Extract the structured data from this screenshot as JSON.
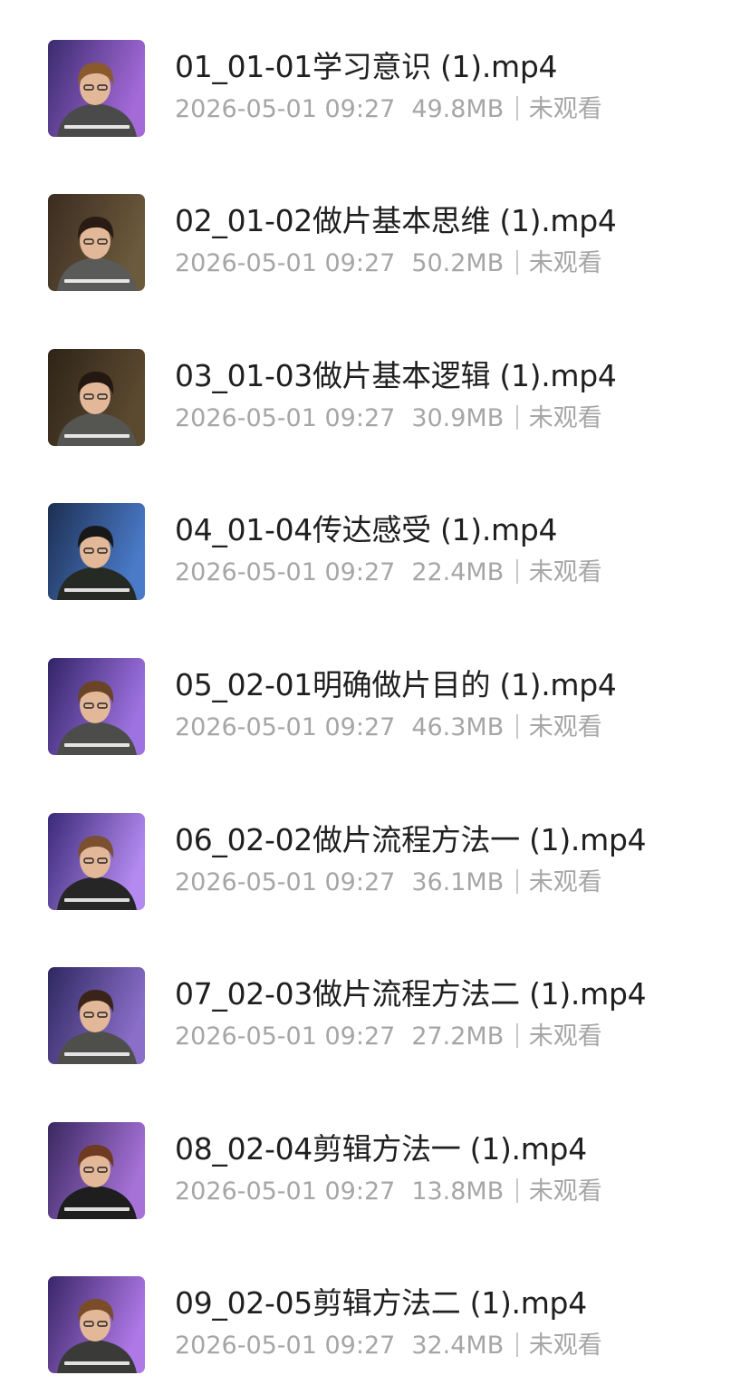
{
  "files": [
    {
      "name": "01_01-01学习意识 (1).mp4",
      "date": "2026-05-01 09:27",
      "size": "49.8MB",
      "status": "未观看",
      "thumb": {
        "bg1": "#3a2b6e",
        "bg2": "#a46ad8",
        "hair": "#8a5a2c",
        "shirt": "#4a4a4a",
        "caption": "#ffffff"
      }
    },
    {
      "name": "02_01-02做片基本思维 (1).mp4",
      "date": "2026-05-01 09:27",
      "size": "50.2MB",
      "status": "未观看",
      "thumb": {
        "bg1": "#3b2c20",
        "bg2": "#6b5a3c",
        "hair": "#2a1c14",
        "shirt": "#5a5a58",
        "caption": "#ffffff"
      }
    },
    {
      "name": "03_01-03做片基本逻辑 (1).mp4",
      "date": "2026-05-01 09:27",
      "size": "30.9MB",
      "status": "未观看",
      "thumb": {
        "bg1": "#2e2418",
        "bg2": "#5c4a30",
        "hair": "#231812",
        "shirt": "#555552",
        "caption": "#ffffff"
      }
    },
    {
      "name": "04_01-04传达感受 (1).mp4",
      "date": "2026-05-01 09:27",
      "size": "22.4MB",
      "status": "未观看",
      "thumb": {
        "bg1": "#1d2f52",
        "bg2": "#4a7ac8",
        "hair": "#181818",
        "shirt": "#262a24",
        "caption": "#ffffff"
      }
    },
    {
      "name": "05_02-01明确做片目的 (1).mp4",
      "date": "2026-05-01 09:27",
      "size": "46.3MB",
      "status": "未观看",
      "thumb": {
        "bg1": "#322468",
        "bg2": "#9e72e0",
        "hair": "#6a4426",
        "shirt": "#4c4c4a",
        "caption": "#ffffff"
      }
    },
    {
      "name": "06_02-02做片流程方法一 (1).mp4",
      "date": "2026-05-01 09:27",
      "size": "36.1MB",
      "status": "未观看",
      "thumb": {
        "bg1": "#3a2a78",
        "bg2": "#b48af0",
        "hair": "#7a5030",
        "shirt": "#262626",
        "caption": "#ffffff"
      }
    },
    {
      "name": "07_02-03做片流程方法二 (1).mp4",
      "date": "2026-05-01 09:27",
      "size": "27.2MB",
      "status": "未观看",
      "thumb": {
        "bg1": "#2e2860",
        "bg2": "#8a6ec8",
        "hair": "#3a2418",
        "shirt": "#4e4e4a",
        "caption": "#ffffff"
      }
    },
    {
      "name": "08_02-04剪辑方法一 (1).mp4",
      "date": "2026-05-01 09:27",
      "size": "13.8MB",
      "status": "未观看",
      "thumb": {
        "bg1": "#3a2860",
        "bg2": "#a672d8",
        "hair": "#6e3a22",
        "shirt": "#1e1e1e",
        "caption": "#ffffff"
      }
    },
    {
      "name": "09_02-05剪辑方法二 (1).mp4",
      "date": "2026-05-01 09:27",
      "size": "32.4MB",
      "status": "未观看",
      "thumb": {
        "bg1": "#3a2668",
        "bg2": "#ae78e6",
        "hair": "#7a4c2a",
        "shirt": "#3a3a38",
        "caption": "#ffffff"
      }
    }
  ]
}
